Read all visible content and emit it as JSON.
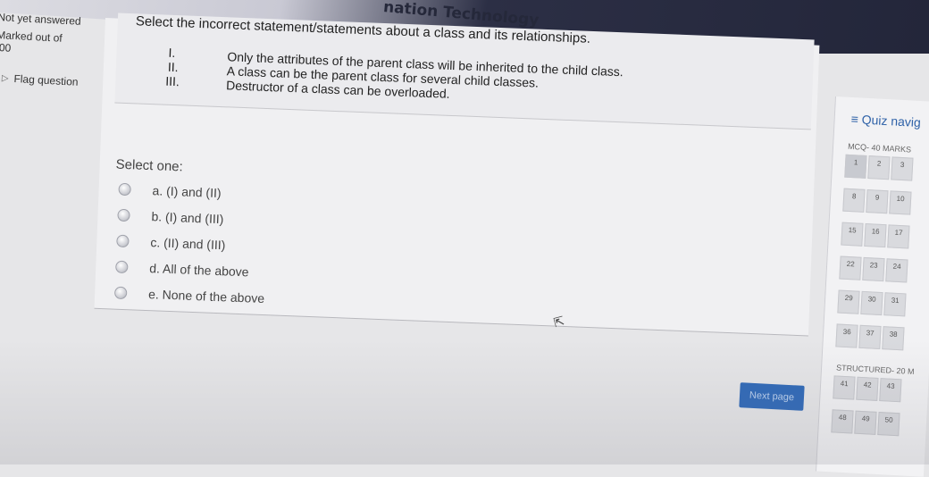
{
  "header": {
    "title": "nation Technology"
  },
  "info": {
    "state": "Not yet answered",
    "marked_line1": "Marked out of",
    "marked_line2": ".00",
    "flag": "Flag question"
  },
  "question": {
    "prompt": "Select the incorrect statement/statements about a class and its relationships.",
    "statements": [
      {
        "num": "I.",
        "text": "Only the attributes of the parent class will be inherited to the child class."
      },
      {
        "num": "II.",
        "text": "A class can be the parent class for several child classes."
      },
      {
        "num": "III.",
        "text": "Destructor of a class can be overloaded."
      }
    ],
    "select_label": "Select one:",
    "options": [
      "a. (I) and (II)",
      "b. (I) and (III)",
      "c. (II) and (III)",
      "d. All of the above",
      "e. None of the above"
    ]
  },
  "next_button": "Next page",
  "nav": {
    "title": "Quiz navig",
    "section1": "MCQ- 40 MARKS",
    "rows": [
      [
        "1",
        "2",
        "3"
      ],
      [
        "8",
        "9",
        "10"
      ],
      [
        "15",
        "16",
        "17"
      ],
      [
        "22",
        "23",
        "24"
      ],
      [
        "29",
        "30",
        "31"
      ],
      [
        "36",
        "37",
        "38"
      ]
    ],
    "section2": "STRUCTURED- 20 M",
    "rows2": [
      [
        "41",
        "42",
        "43"
      ],
      [
        "48",
        "49",
        "50"
      ]
    ]
  }
}
